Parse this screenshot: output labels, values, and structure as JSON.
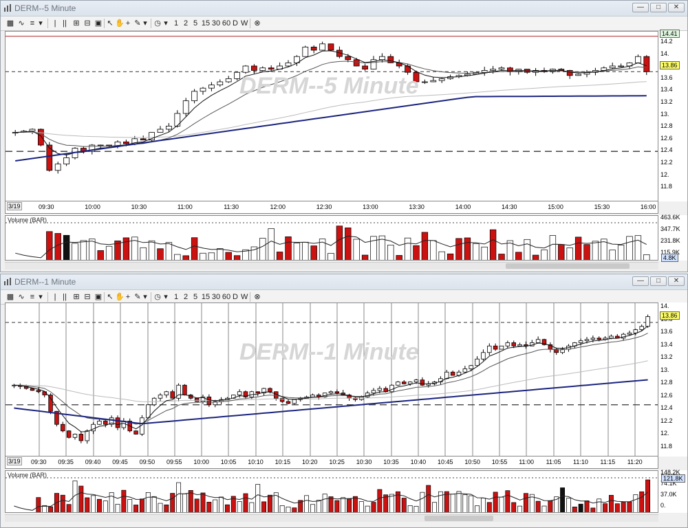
{
  "windows": [
    {
      "title": "DERM--5 Minute",
      "watermark": "DERM--5 Minute",
      "toolbar": {
        "intervals": [
          "1",
          "2",
          "5",
          "15",
          "30",
          "60",
          "D",
          "W"
        ]
      },
      "y_ticks": [
        "14.2",
        "14.",
        "13.8",
        "13.6",
        "13.4",
        "13.2",
        "13.",
        "12.8",
        "12.6",
        "12.4",
        "12.2",
        "12.",
        "11.8"
      ],
      "top_price_label": "14.41",
      "current_price_label": "13.86",
      "x_date": "3/19",
      "x_ticks": [
        "09:30",
        "10:00",
        "10:30",
        "11:00",
        "11:30",
        "12:00",
        "12:30",
        "13:00",
        "13:30",
        "14:00",
        "14:30",
        "15:00",
        "15:30",
        "16:00"
      ],
      "volume_title": "Volume (BAR)",
      "volume_ticks": [
        "463.6K",
        "347.7K",
        "231.8K",
        "115.9K"
      ],
      "volume_current": "4.8K"
    },
    {
      "title": "DERM--1 Minute",
      "watermark": "DERM--1 Minute",
      "toolbar": {
        "intervals": [
          "1",
          "2",
          "5",
          "15",
          "30",
          "60",
          "D",
          "W"
        ]
      },
      "y_ticks": [
        "14.",
        "13.8",
        "13.6",
        "13.4",
        "13.2",
        "13.",
        "12.8",
        "12.6",
        "12.4",
        "12.2",
        "12.",
        "11.8"
      ],
      "current_price_label": "13.86",
      "x_date": "3/19",
      "x_ticks": [
        "09:30",
        "09:35",
        "09:40",
        "09:45",
        "09:50",
        "09:55",
        "10:00",
        "10:05",
        "10:10",
        "10:15",
        "10:20",
        "10:25",
        "10:30",
        "10:35",
        "10:40",
        "10:45",
        "10:50",
        "10:55",
        "11:00",
        "11:05",
        "11:10",
        "11:15",
        "11:20"
      ],
      "volume_title": "Volume (BAR)",
      "volume_ticks": [
        "148.2K",
        "74.1K",
        "37.0K",
        "0."
      ],
      "volume_current": "121.8K"
    }
  ],
  "colors": {
    "up_fill": "#ffffff",
    "down_fill": "#cc1111",
    "vwap": "#1a237e",
    "accent": "#ffff66"
  },
  "icons": [
    "chart-app-icon",
    "crosshair-icon",
    "hand-icon",
    "pencil-icon",
    "clock-icon",
    "close-circle-icon"
  ]
}
